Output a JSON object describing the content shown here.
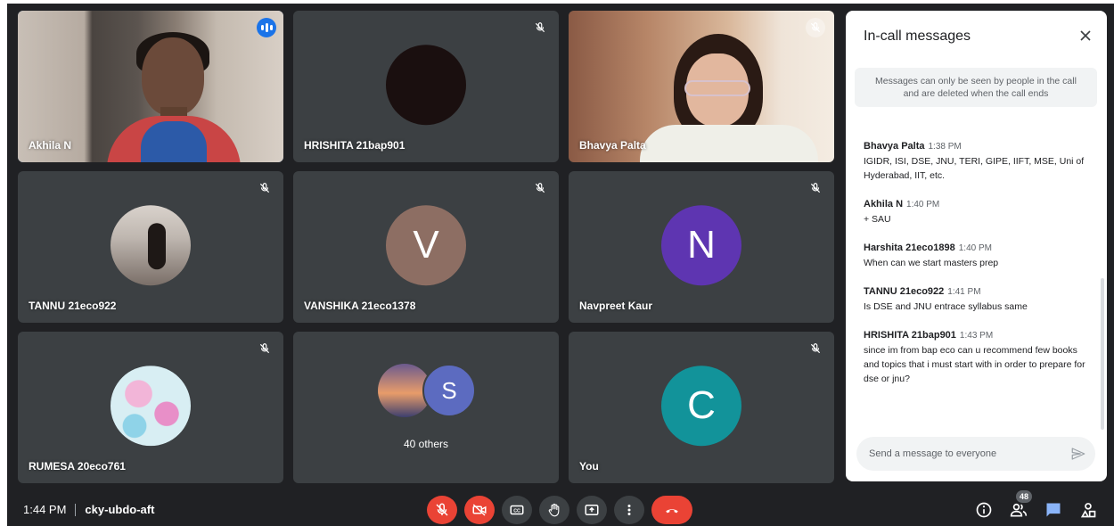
{
  "participants": [
    {
      "name": "Akhila N",
      "kind": "video",
      "speaking": true
    },
    {
      "name": "HRISHITA 21bap901",
      "kind": "avatar",
      "avatar_color": "#1a0f0f",
      "muted": true
    },
    {
      "name": "Bhavya Palta",
      "kind": "video",
      "muted": true
    },
    {
      "name": "TANNU 21eco922",
      "kind": "photo-avatar",
      "muted": true
    },
    {
      "name": "VANSHIKA 21eco1378",
      "kind": "avatar",
      "initial": "V",
      "avatar_color": "#8d6e63",
      "muted": true
    },
    {
      "name": "Navpreet Kaur",
      "kind": "avatar",
      "initial": "N",
      "avatar_color": "#5e35b1",
      "muted": true
    },
    {
      "name": "RUMESA 20eco761",
      "kind": "photo-avatar",
      "muted": true
    },
    {
      "name": "40 others",
      "kind": "group",
      "initial": "S",
      "avatar_color": "#5c6bc0"
    },
    {
      "name": "You",
      "kind": "avatar",
      "initial": "C",
      "avatar_color": "#12939a",
      "muted": true
    }
  ],
  "chat": {
    "title": "In-call messages",
    "notice": "Messages can only be seen by people in the call and are deleted when the call ends",
    "messages": [
      {
        "sender": "Bhavya Palta",
        "time": "1:38 PM",
        "text": "IGIDR, ISI, DSE, JNU, TERI, GIPE, IIFT, MSE, Uni of Hyderabad, IIT, etc."
      },
      {
        "sender": "Akhila N",
        "time": "1:40 PM",
        "text": "+ SAU"
      },
      {
        "sender": "Harshita 21eco1898",
        "time": "1:40 PM",
        "text": "When can we start masters prep"
      },
      {
        "sender": "TANNU 21eco922",
        "time": "1:41 PM",
        "text": "Is DSE and JNU entrace syllabus same"
      },
      {
        "sender": "HRISHITA 21bap901",
        "time": "1:43 PM",
        "text": "since im from bap eco can u recommend few books and topics that i must start with in order to prepare for dse or jnu?"
      }
    ],
    "input_placeholder": "Send a message to everyone"
  },
  "bottom_bar": {
    "time": "1:44 PM",
    "meeting_code": "cky-ubdo-aft",
    "participant_count": "48",
    "controls": [
      "mic-off-icon",
      "camera-off-icon",
      "captions-icon",
      "raise-hand-icon",
      "present-icon",
      "more-icon",
      "hang-up-icon"
    ],
    "side": [
      "info-icon",
      "people-icon",
      "chat-icon",
      "activities-icon"
    ]
  },
  "colors": {
    "background": "#202124",
    "tile": "#3c4043",
    "accent": "#8ab4f8",
    "danger": "#ea4335",
    "chat_active": "#8ab4f8"
  }
}
